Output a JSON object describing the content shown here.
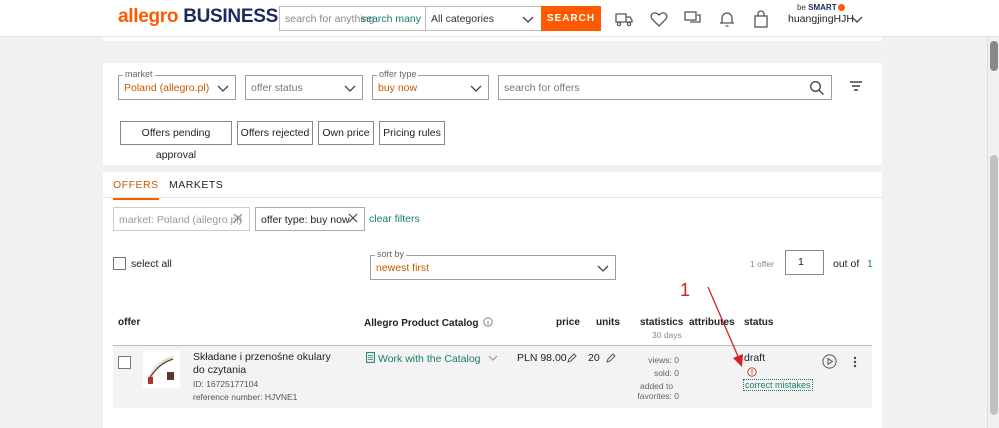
{
  "header": {
    "logo_part1": "allegro",
    "logo_part2": "BUSINESS",
    "search_placeholder": "search for anything",
    "search_many": "search many",
    "category": "All categories",
    "search_button": "SEARCH",
    "besmart_prefix": "be",
    "besmart_brand": "SMART",
    "username": "huangjingHJH"
  },
  "filters": {
    "market_label": "market",
    "market_value": "Poland (allegro.pl)",
    "offer_status_placeholder": "offer status",
    "offer_type_label": "offer type",
    "offer_type_value": "buy now",
    "search_offers_placeholder": "search for offers",
    "quick_buttons": [
      "Offers pending approval",
      "Offers rejected",
      "Own price",
      "Pricing rules"
    ]
  },
  "tabs": [
    "OFFERS",
    "MARKETS"
  ],
  "active_filters": {
    "chip_market": "market: Poland (allegro.pl)",
    "chip_offer_type": "offer type: buy now",
    "clear": "clear filters"
  },
  "list_controls": {
    "select_all": "select all",
    "sort_label": "sort by",
    "sort_value": "newest first",
    "offer_count": "1 offer",
    "page": "1",
    "out_of": "out of",
    "total_pages": "1"
  },
  "columns": {
    "offer": "offer",
    "catalog": "Allegro Product Catalog",
    "price": "price",
    "units": "units",
    "statistics": "statistics",
    "statistics_sub": "30 days",
    "attributes": "attributes",
    "status": "status"
  },
  "offer_row": {
    "name": "Składane i przenośne okulary do czytania",
    "id": "ID: 16725177104",
    "reference": "reference number: HJVNE1",
    "catalog_link": "Work with the Catalog",
    "price": "PLN 98.00",
    "units": "20",
    "views": "views: 0",
    "sold": "sold: 0",
    "added_to": "added to",
    "favorites": "favorites: 0",
    "status": "draft",
    "correct": "correct mistakes"
  },
  "annotation": {
    "number": "1"
  },
  "colors": {
    "accent": "#ff5a00",
    "link": "#1a7d6e",
    "brand_navy": "#1b2a5c",
    "annotation_red": "#d82020"
  }
}
